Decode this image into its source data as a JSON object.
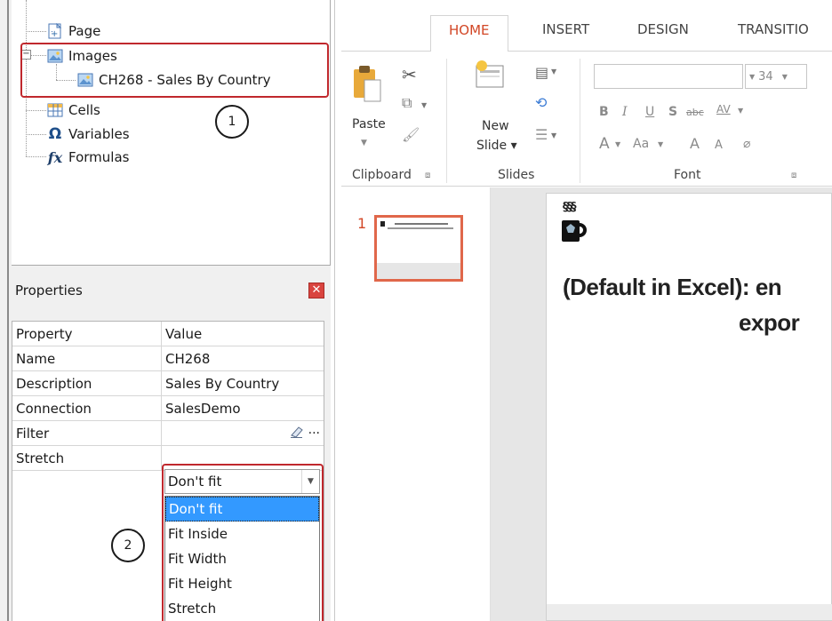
{
  "tree": {
    "items": [
      {
        "label": "Page",
        "icon": "page-icon"
      },
      {
        "label": "Images",
        "icon": "images-icon"
      },
      {
        "label": "CH268 - Sales By Country",
        "icon": "image-icon"
      },
      {
        "label": "Cells",
        "icon": "cells-icon"
      },
      {
        "label": "Variables",
        "icon": "omega-icon"
      },
      {
        "label": "Formulas",
        "icon": "fx-icon"
      }
    ],
    "callout1": "1"
  },
  "properties": {
    "title": "Properties",
    "headers": {
      "property": "Property",
      "value": "Value"
    },
    "rows": [
      {
        "name": "Name",
        "value": "CH268"
      },
      {
        "name": "Description",
        "value": "Sales By Country"
      },
      {
        "name": "Connection",
        "value": "SalesDemo"
      },
      {
        "name": "Filter",
        "value": ""
      },
      {
        "name": "Stretch",
        "value": "Don't fit"
      }
    ],
    "stretch_options": [
      "Don't fit",
      "Fit Inside",
      "Fit Width",
      "Fit Height",
      "Stretch"
    ],
    "callout2": "2"
  },
  "ribbon": {
    "tabs": [
      "HOME",
      "INSERT",
      "DESIGN",
      "TRANSITIO"
    ],
    "active_tab": "HOME",
    "paste": "Paste",
    "new": "New",
    "slide": "Slide",
    "groups": [
      "Clipboard",
      "Slides",
      "Font"
    ],
    "font_size": "34",
    "font_buttons": [
      "B",
      "I",
      "U",
      "S",
      "abc",
      "AV",
      "A",
      "Aa",
      "A",
      "A"
    ]
  },
  "slides": {
    "thumb_number": "1",
    "title_line1": "(Default in Excel): en",
    "title_line2": "expor",
    "logo_steam": "§§§"
  },
  "colors": {
    "accent": "#d24726",
    "highlight": "#c0282d",
    "selection": "#3399ff"
  }
}
